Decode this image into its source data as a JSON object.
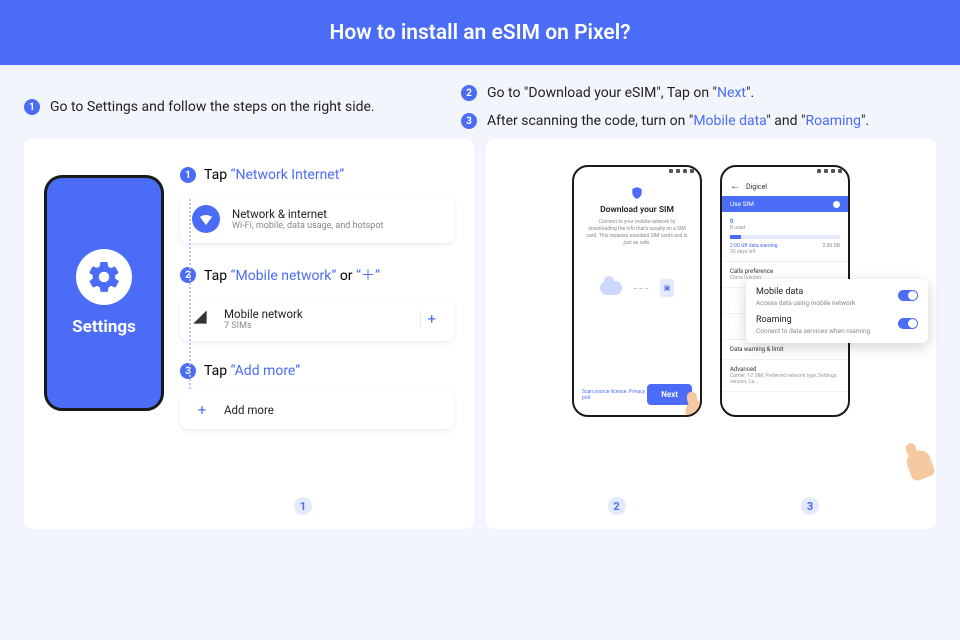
{
  "header": {
    "title": "How to install an eSIM on Pixel?"
  },
  "steps": {
    "s1": {
      "num": "1",
      "text": "Go to Settings and follow the steps on the right side."
    },
    "s2": {
      "num": "2",
      "prefix": "Go to \"Download your eSIM\", Tap on \"",
      "link": "Next",
      "suffix": "\"."
    },
    "s3": {
      "num": "3",
      "prefix": "After scanning the code, turn on \"",
      "link1": "Mobile data",
      "mid": "\" and \"",
      "link2": "Roaming",
      "suffix": "\"."
    }
  },
  "card1": {
    "phone_label": "Settings",
    "taps": {
      "t1": {
        "num": "1",
        "label": "Tap ",
        "link": "“Network Internet”"
      },
      "t2": {
        "num": "2",
        "label": "Tap ",
        "link": "“Mobile network”",
        "or": " or ",
        "plus": "“＋”"
      },
      "t3": {
        "num": "3",
        "label": "Tap ",
        "link": "“Add more”"
      }
    },
    "rows": {
      "network": {
        "title": "Network & internet",
        "sub": "Wi-Fi, mobile, data usage, and hotspot"
      },
      "mobile": {
        "title": "Mobile network",
        "sub": "7 SIMs",
        "plus": "+"
      },
      "add": {
        "plus": "+",
        "title": "Add more"
      }
    },
    "badge": "1"
  },
  "card2": {
    "download": {
      "title": "Download your SIM",
      "desc": "Connect to your mobile network by downloading the info that's usually on a SIM card. This replaces standard SIM cards and is just as safe.",
      "footer_left": "Scan source license. Privacy poli",
      "next": "Next"
    },
    "settings": {
      "carrier": "Digicel",
      "use_sim": "Use SIM",
      "zero": "0",
      "bused": "B used",
      "warn": "2.00 GB data warning",
      "days": "30 days left",
      "limit": "2.00 GB",
      "calls": "Calls preference",
      "calls_sub": "China Unicom",
      "dw": "Data warning & limit",
      "adv": "Advanced",
      "adv_sub": "Carrier, T-2 SIM, Preferred network type, Settings version, Ca..."
    },
    "popup": {
      "mdata_t": "Mobile data",
      "mdata_s": "Access data using mobile network",
      "roam_t": "Roaming",
      "roam_s": "Connect to data services when roaming"
    },
    "badge2": "2",
    "badge3": "3"
  }
}
